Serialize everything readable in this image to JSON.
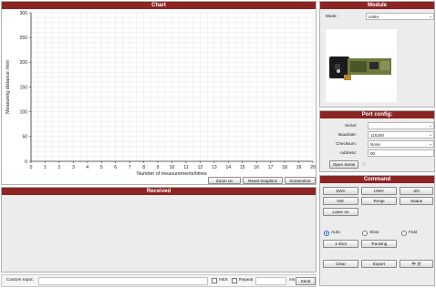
{
  "chart_panel": {
    "title": "Chart"
  },
  "chart_data": {
    "type": "line",
    "title": "",
    "xlabel": "Number of measurements/times",
    "ylabel": "Measuring distance /mm",
    "xlim": [
      0,
      20
    ],
    "ylim": [
      0,
      300
    ],
    "x_ticks": [
      "0",
      "1",
      "2",
      "3",
      "4",
      "5",
      "6",
      "7",
      "8",
      "9",
      "10",
      "11",
      "12",
      "13",
      "14",
      "15",
      "16",
      "17",
      "18",
      "19",
      "20"
    ],
    "y_ticks": [
      "0",
      "50",
      "100",
      "150",
      "200",
      "250",
      "300"
    ],
    "grid": true,
    "series": []
  },
  "chart_toolbar": {
    "zoom_on": "Zoom on",
    "reset_graphics": "Reset Graphics",
    "screenshot": "Screenshot"
  },
  "received_panel": {
    "title": "Received"
  },
  "bottom_bar": {
    "custom_input_label": "Custom Input:",
    "hex_label": "HEX",
    "repeat_label": "Repeat",
    "ms_label": "ms",
    "send_label": "Send"
  },
  "module_panel": {
    "title": "Module",
    "mode_label": "Mode:",
    "mode_value": "U85A"
  },
  "port_config": {
    "title": "Port config:",
    "serial_label": "Serial:",
    "serial_value": "",
    "baudrate_label": "Baudrate:",
    "baudrate_value": "115200",
    "checksum_label": "Checksum:",
    "checksum_value": "None",
    "address_label": "Address:",
    "address_value": "00",
    "open_serial": "Open Serial"
  },
  "command_panel": {
    "title": "Command",
    "swv": "SWV",
    "hwv": "HWV",
    "sn": "SN",
    "volt": "Volt.",
    "tempr": "Tempr",
    "status": "Status",
    "laser_on": "Laser  on",
    "auto": "Auto",
    "slow": "Slow",
    "fast": "Fast",
    "one_shot": "1-shot",
    "tracking": "Tracking",
    "clear": "Clear",
    "export": "Export",
    "lang": "中  文"
  }
}
